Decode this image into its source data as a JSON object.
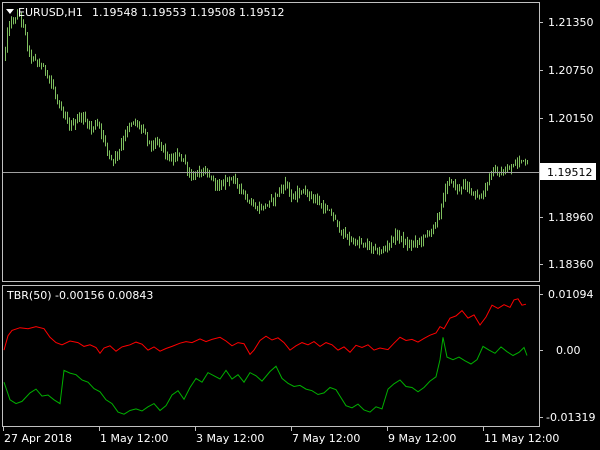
{
  "main_panel": {
    "symbol_label": "EURUSD,H1",
    "ohlc_label": "1.19548 1.19553 1.19508 1.19512",
    "price_axis_ticks": [
      "1.21350",
      "1.20750",
      "1.20150",
      "1.19512",
      "1.18960",
      "1.18360"
    ],
    "current_price": "1.19512"
  },
  "indicator_panel": {
    "label": "TBR(50) -0.00156 0.00843",
    "axis_ticks": [
      "0.01094",
      "0.00",
      "-0.01319"
    ]
  },
  "time_axis_ticks": [
    "27 Apr 2018",
    "1 May 12:00",
    "3 May 12:00",
    "7 May 12:00",
    "9 May 12:00",
    "11 May 12:00"
  ],
  "colors": {
    "background": "#000000",
    "bars": "#7fbf5f",
    "red_line": "#ff0000",
    "green_line": "#00b000",
    "text": "#ffffff",
    "grid_line": "#c0c0c0"
  },
  "chart_data": [
    {
      "type": "ohlc",
      "ylim": [
        1.18,
        1.216
      ],
      "close_anchors": [
        [
          0,
          1.207
        ],
        [
          4,
          1.209
        ],
        [
          8,
          1.213
        ],
        [
          14,
          1.214
        ],
        [
          19,
          1.2145
        ],
        [
          24,
          1.2125
        ],
        [
          28,
          1.2095
        ],
        [
          34,
          1.2085
        ],
        [
          44,
          1.2075
        ],
        [
          50,
          1.206
        ],
        [
          56,
          1.2035
        ],
        [
          62,
          1.2015
        ],
        [
          70,
          1.2
        ],
        [
          80,
          1.2015
        ],
        [
          88,
          1.2003
        ],
        [
          92,
          1.1995
        ],
        [
          96,
          1.2008
        ],
        [
          100,
          1.1998
        ],
        [
          106,
          1.1972
        ],
        [
          112,
          1.1955
        ],
        [
          118,
          1.1968
        ],
        [
          126,
          1.1995
        ],
        [
          133,
          1.2005
        ],
        [
          140,
          1.2
        ],
        [
          150,
          1.1975
        ],
        [
          160,
          1.1978
        ],
        [
          166,
          1.1962
        ],
        [
          172,
          1.1955
        ],
        [
          178,
          1.1965
        ],
        [
          184,
          1.1955
        ],
        [
          190,
          1.1935
        ],
        [
          196,
          1.1938
        ],
        [
          202,
          1.1942
        ],
        [
          212,
          1.1932
        ],
        [
          220,
          1.192
        ],
        [
          226,
          1.1935
        ],
        [
          236,
          1.1928
        ],
        [
          246,
          1.1908
        ],
        [
          254,
          1.1895
        ],
        [
          262,
          1.1895
        ],
        [
          270,
          1.1902
        ],
        [
          278,
          1.1915
        ],
        [
          286,
          1.1928
        ],
        [
          292,
          1.1905
        ],
        [
          298,
          1.1915
        ],
        [
          306,
          1.1915
        ],
        [
          316,
          1.1905
        ],
        [
          322,
          1.1895
        ],
        [
          332,
          1.1885
        ],
        [
          338,
          1.187
        ],
        [
          344,
          1.1858
        ],
        [
          352,
          1.1852
        ],
        [
          360,
          1.1848
        ],
        [
          368,
          1.1845
        ],
        [
          376,
          1.1838
        ],
        [
          382,
          1.1838
        ],
        [
          388,
          1.1848
        ],
        [
          394,
          1.1858
        ],
        [
          400,
          1.1858
        ],
        [
          406,
          1.1845
        ],
        [
          412,
          1.1848
        ],
        [
          420,
          1.1852
        ],
        [
          428,
          1.1862
        ],
        [
          436,
          1.1875
        ],
        [
          440,
          1.1892
        ],
        [
          444,
          1.1915
        ],
        [
          450,
          1.1932
        ],
        [
          456,
          1.1918
        ],
        [
          462,
          1.1925
        ],
        [
          468,
          1.192
        ],
        [
          474,
          1.1915
        ],
        [
          480,
          1.1905
        ],
        [
          486,
          1.1925
        ],
        [
          492,
          1.1945
        ],
        [
          498,
          1.1938
        ],
        [
          506,
          1.1942
        ],
        [
          512,
          1.1948
        ],
        [
          518,
          1.1955
        ],
        [
          524,
          1.1958
        ],
        [
          530,
          1.1951
        ]
      ]
    },
    {
      "type": "line",
      "ylim": [
        -0.0144,
        0.0118
      ],
      "series": [
        {
          "color": "#ff0000",
          "points": [
            [
              4,
              -0.0002
            ],
            [
              8,
              0.0025
            ],
            [
              12,
              0.0035
            ],
            [
              20,
              0.004
            ],
            [
              28,
              0.0038
            ],
            [
              36,
              0.0042
            ],
            [
              44,
              0.0038
            ],
            [
              50,
              0.0022
            ],
            [
              56,
              0.0012
            ],
            [
              62,
              0.0008
            ],
            [
              70,
              0.0015
            ],
            [
              78,
              0.0012
            ],
            [
              84,
              0.0005
            ],
            [
              90,
              0.0008
            ],
            [
              96,
              0.0003
            ],
            [
              100,
              -0.0008
            ],
            [
              104,
              0.0002
            ],
            [
              110,
              0.0006
            ],
            [
              116,
              -0.0004
            ],
            [
              122,
              0.0004
            ],
            [
              130,
              0.0008
            ],
            [
              136,
              0.0013
            ],
            [
              142,
              0.0009
            ],
            [
              148,
              -0.0002
            ],
            [
              154,
              0.0004
            ],
            [
              160,
              -0.0004
            ],
            [
              166,
              0.0001
            ],
            [
              172,
              0.0005
            ],
            [
              180,
              0.0011
            ],
            [
              186,
              0.0014
            ],
            [
              192,
              0.0012
            ],
            [
              200,
              0.0019
            ],
            [
              206,
              0.0014
            ],
            [
              212,
              0.0018
            ],
            [
              220,
              0.0022
            ],
            [
              226,
              0.0015
            ],
            [
              232,
              0.0006
            ],
            [
              238,
              0.0012
            ],
            [
              244,
              0.001
            ],
            [
              250,
              -0.001
            ],
            [
              254,
              -0.0002
            ],
            [
              260,
              0.0016
            ],
            [
              266,
              0.0024
            ],
            [
              272,
              0.0017
            ],
            [
              278,
              0.0021
            ],
            [
              284,
              0.0012
            ],
            [
              290,
              -0.0002
            ],
            [
              296,
              0.0006
            ],
            [
              302,
              0.0012
            ],
            [
              308,
              0.0008
            ],
            [
              314,
              0.0014
            ],
            [
              320,
              0.0005
            ],
            [
              326,
              0.0012
            ],
            [
              332,
              0.0008
            ],
            [
              338,
              -0.0002
            ],
            [
              344,
              0.0004
            ],
            [
              350,
              -0.0006
            ],
            [
              356,
              0.0007
            ],
            [
              362,
              0.0003
            ],
            [
              368,
              0.0008
            ],
            [
              374,
              -0.0002
            ],
            [
              380,
              0.0002
            ],
            [
              388,
              -0.0001
            ],
            [
              394,
              0.0011
            ],
            [
              400,
              0.0022
            ],
            [
              406,
              0.0016
            ],
            [
              412,
              0.0018
            ],
            [
              418,
              0.0013
            ],
            [
              424,
              0.002
            ],
            [
              430,
              0.0026
            ],
            [
              436,
              0.003
            ],
            [
              440,
              0.0042
            ],
            [
              444,
              0.0038
            ],
            [
              450,
              0.0058
            ],
            [
              456,
              0.0062
            ],
            [
              462,
              0.0072
            ],
            [
              468,
              0.0058
            ],
            [
              474,
              0.0064
            ],
            [
              480,
              0.0045
            ],
            [
              486,
              0.006
            ],
            [
              492,
              0.0082
            ],
            [
              498,
              0.0076
            ],
            [
              504,
              0.0083
            ],
            [
              510,
              0.0078
            ],
            [
              514,
              0.0092
            ],
            [
              518,
              0.0094
            ],
            [
              522,
              0.0082
            ],
            [
              526,
              0.0084
            ]
          ]
        },
        {
          "color": "#00b000",
          "points": [
            [
              4,
              -0.0062
            ],
            [
              10,
              -0.0095
            ],
            [
              16,
              -0.0102
            ],
            [
              22,
              -0.0098
            ],
            [
              30,
              -0.0082
            ],
            [
              36,
              -0.0075
            ],
            [
              42,
              -0.0088
            ],
            [
              48,
              -0.0086
            ],
            [
              54,
              -0.0095
            ],
            [
              60,
              -0.0102
            ],
            [
              64,
              -0.004
            ],
            [
              70,
              -0.0045
            ],
            [
              76,
              -0.0048
            ],
            [
              82,
              -0.0058
            ],
            [
              88,
              -0.0062
            ],
            [
              94,
              -0.0074
            ],
            [
              100,
              -0.008
            ],
            [
              106,
              -0.0095
            ],
            [
              112,
              -0.0102
            ],
            [
              118,
              -0.0118
            ],
            [
              124,
              -0.0122
            ],
            [
              130,
              -0.0115
            ],
            [
              136,
              -0.0112
            ],
            [
              142,
              -0.0116
            ],
            [
              148,
              -0.0108
            ],
            [
              154,
              -0.0102
            ],
            [
              160,
              -0.0115
            ],
            [
              166,
              -0.0106
            ],
            [
              172,
              -0.0086
            ],
            [
              178,
              -0.0078
            ],
            [
              184,
              -0.0094
            ],
            [
              190,
              -0.0072
            ],
            [
              196,
              -0.0055
            ],
            [
              202,
              -0.0062
            ],
            [
              208,
              -0.0044
            ],
            [
              214,
              -0.005
            ],
            [
              220,
              -0.0056
            ],
            [
              226,
              -0.004
            ],
            [
              232,
              -0.0056
            ],
            [
              238,
              -0.0048
            ],
            [
              244,
              -0.0062
            ],
            [
              250,
              -0.0044
            ],
            [
              256,
              -0.005
            ],
            [
              262,
              -0.006
            ],
            [
              270,
              -0.0042
            ],
            [
              276,
              -0.0032
            ],
            [
              282,
              -0.0055
            ],
            [
              288,
              -0.0064
            ],
            [
              294,
              -0.007
            ],
            [
              300,
              -0.0068
            ],
            [
              306,
              -0.0075
            ],
            [
              312,
              -0.0078
            ],
            [
              318,
              -0.0085
            ],
            [
              324,
              -0.0082
            ],
            [
              330,
              -0.0072
            ],
            [
              336,
              -0.0076
            ],
            [
              340,
              -0.0088
            ],
            [
              346,
              -0.0106
            ],
            [
              352,
              -0.011
            ],
            [
              358,
              -0.0103
            ],
            [
              364,
              -0.0114
            ],
            [
              370,
              -0.0118
            ],
            [
              376,
              -0.0108
            ],
            [
              382,
              -0.0112
            ],
            [
              388,
              -0.0075
            ],
            [
              394,
              -0.0065
            ],
            [
              400,
              -0.0058
            ],
            [
              406,
              -0.007
            ],
            [
              412,
              -0.0072
            ],
            [
              418,
              -0.008
            ],
            [
              424,
              -0.0072
            ],
            [
              430,
              -0.006
            ],
            [
              436,
              -0.0052
            ],
            [
              440,
              -0.002
            ],
            [
              443,
              0.0022
            ],
            [
              447,
              -0.0015
            ],
            [
              453,
              -0.002
            ],
            [
              459,
              -0.0015
            ],
            [
              465,
              -0.0022
            ],
            [
              471,
              -0.0028
            ],
            [
              477,
              -0.002
            ],
            [
              483,
              0.0005
            ],
            [
              489,
              -0.0002
            ],
            [
              495,
              -0.0008
            ],
            [
              501,
              0.0004
            ],
            [
              507,
              -0.0005
            ],
            [
              513,
              -0.0012
            ],
            [
              519,
              -0.0006
            ],
            [
              524,
              0.0003
            ],
            [
              527,
              -0.0012
            ]
          ]
        }
      ]
    }
  ]
}
